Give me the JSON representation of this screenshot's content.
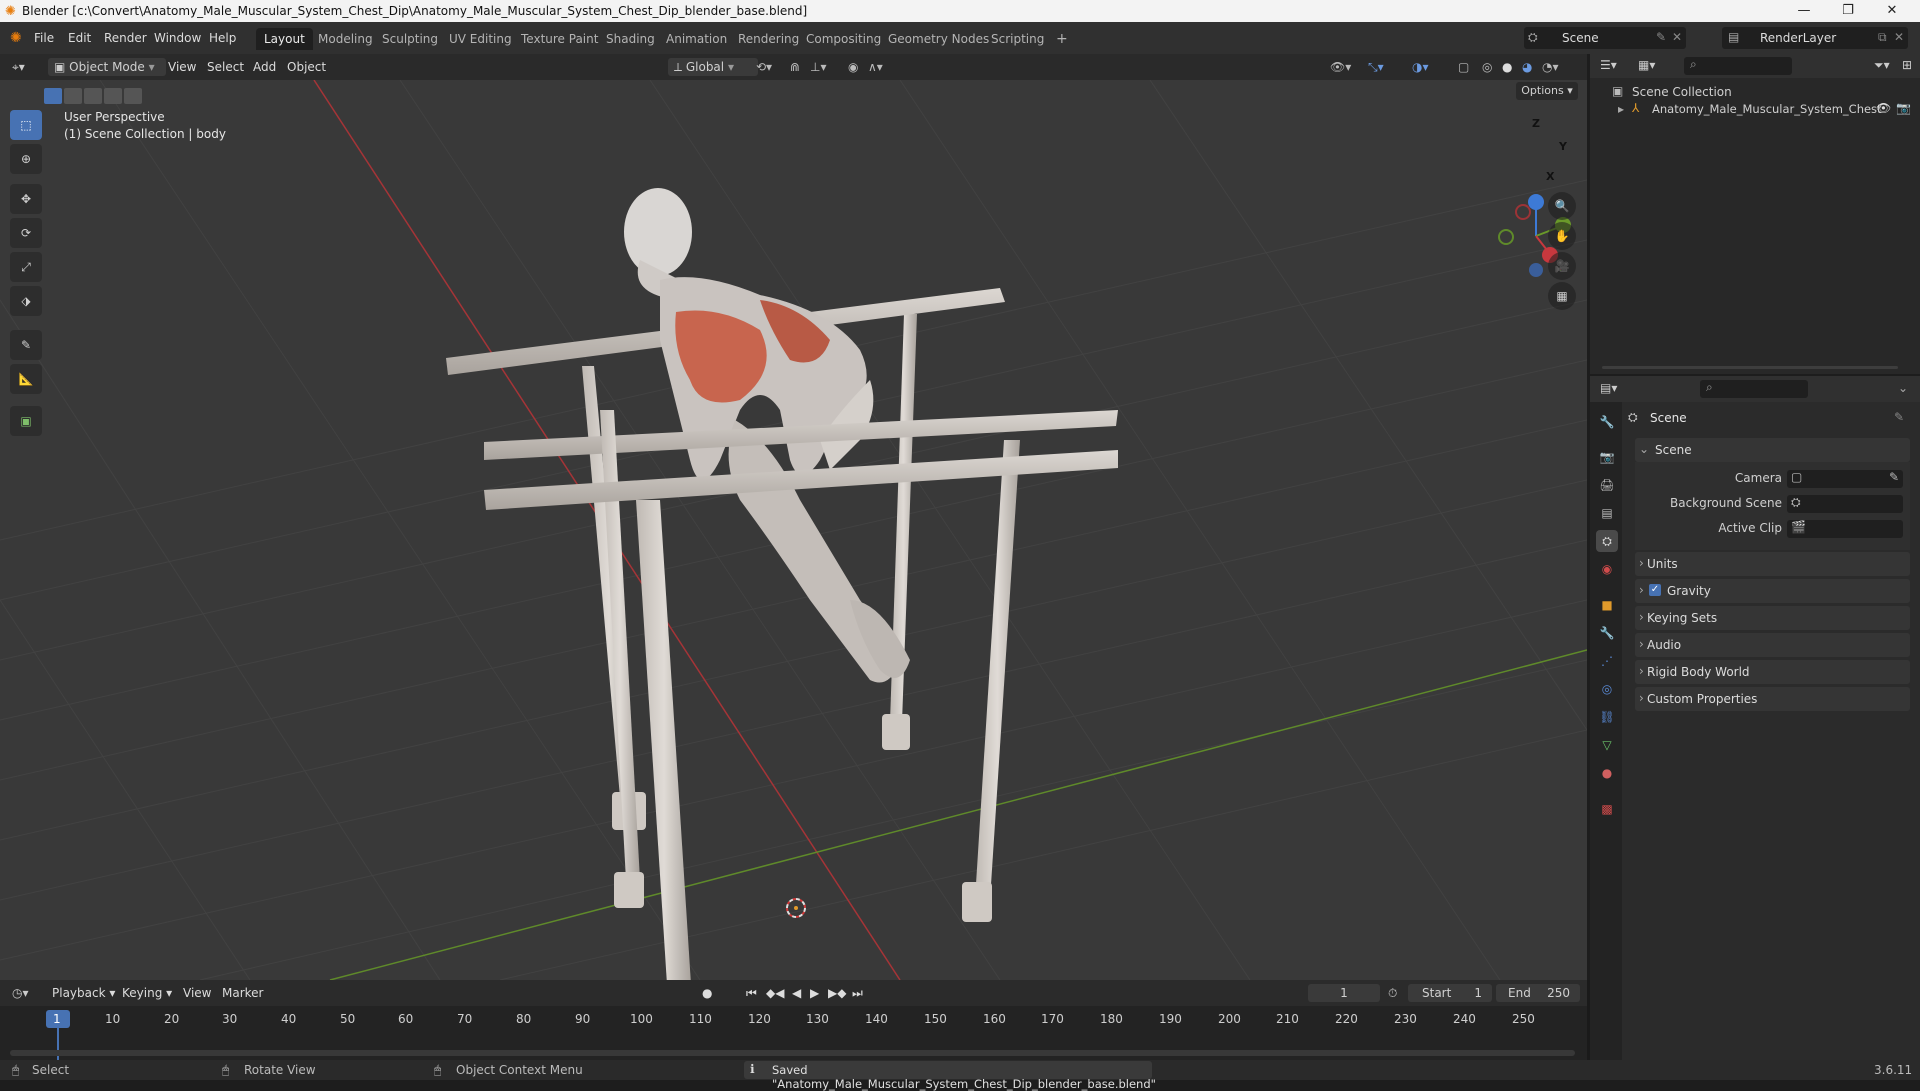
{
  "window": {
    "title": "Blender [c:\\Convert\\Anatomy_Male_Muscular_System_Chest_Dip\\Anatomy_Male_Muscular_System_Chest_Dip_blender_base.blend]",
    "controls": [
      "minimize-icon",
      "maximize-icon",
      "close-icon"
    ]
  },
  "menubar": {
    "items": [
      "File",
      "Edit",
      "Render",
      "Window",
      "Help"
    ]
  },
  "workspaces": {
    "tabs": [
      "Layout",
      "Modeling",
      "Sculpting",
      "UV Editing",
      "Texture Paint",
      "Shading",
      "Animation",
      "Rendering",
      "Compositing",
      "Geometry Nodes",
      "Scripting"
    ],
    "active": "Layout",
    "add": "+"
  },
  "scene_selector": {
    "value": "Scene"
  },
  "renderlayer_selector": {
    "value": "RenderLayer"
  },
  "viewport_header": {
    "mode": "Object Mode",
    "menus": [
      "View",
      "Select",
      "Add",
      "Object"
    ],
    "orientation": "Global",
    "options": "Options"
  },
  "viewport": {
    "perspective": "User Perspective",
    "collection_info": "(1) Scene Collection | body",
    "gizmo": {
      "z": "Z",
      "y": "Y",
      "x": "X"
    }
  },
  "toolbar": {
    "tools": [
      "select-box-icon",
      "cursor-icon",
      "move-icon",
      "rotate-icon",
      "scale-icon",
      "transform-icon",
      "annotate-icon",
      "measure-icon",
      "add-cube-icon"
    ]
  },
  "outliner": {
    "root": "Scene Collection",
    "items": [
      {
        "label": "Anatomy_Male_Muscular_System_Chest"
      }
    ]
  },
  "properties": {
    "context": "Scene",
    "section": "Scene",
    "fields": [
      {
        "label": "Camera",
        "value": ""
      },
      {
        "label": "Background Scene",
        "value": ""
      },
      {
        "label": "Active Clip",
        "value": ""
      }
    ],
    "panels": [
      {
        "label": "Units",
        "checkbox": false
      },
      {
        "label": "Gravity",
        "checkbox": true,
        "checked": true
      },
      {
        "label": "Keying Sets",
        "checkbox": false
      },
      {
        "label": "Audio",
        "checkbox": false
      },
      {
        "label": "Rigid Body World",
        "checkbox": false
      },
      {
        "label": "Custom Properties",
        "checkbox": false
      }
    ]
  },
  "timeline": {
    "menus": [
      "Playback",
      "Keying",
      "View",
      "Marker"
    ],
    "current_frame": "1",
    "start_label": "Start",
    "start": "1",
    "end_label": "End",
    "end": "250",
    "ruler": [
      "1",
      "10",
      "20",
      "30",
      "40",
      "50",
      "60",
      "70",
      "80",
      "90",
      "100",
      "110",
      "120",
      "130",
      "140",
      "150",
      "160",
      "170",
      "180",
      "190",
      "200",
      "210",
      "220",
      "230",
      "240",
      "250"
    ]
  },
  "statusbar": {
    "select": "Select",
    "rotate": "Rotate View",
    "context": "Object Context Menu",
    "message": "Saved \"Anatomy_Male_Muscular_System_Chest_Dip_blender_base.blend\"",
    "version": "3.6.11"
  },
  "colors": {
    "accent": "#4772b3",
    "x_axis": "#c8383e",
    "y_axis": "#6a9a2a",
    "z_axis": "#3d7ad6",
    "muscle": "#c8654e"
  }
}
